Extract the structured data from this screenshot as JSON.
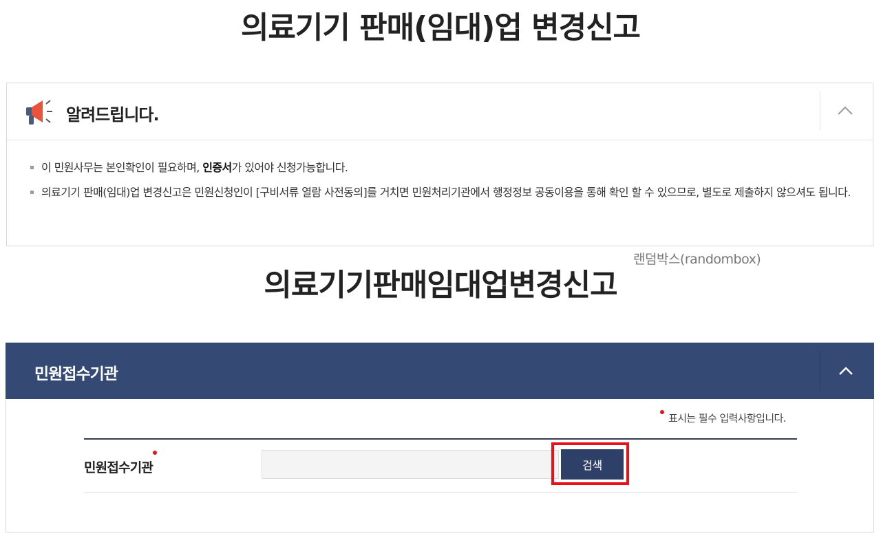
{
  "page": {
    "title": "의료기기 판매(임대)업 변경신고"
  },
  "notice": {
    "title": "알려드립니다.",
    "icon": "megaphone-icon",
    "items": [
      {
        "before": "이 민원사무는 본인확인이 필요하며, ",
        "bold": "인증서",
        "after": "가 있어야 신청가능합니다."
      },
      {
        "text": "의료기기 판매(임대)업 변경신고은 민원신청인이 [구비서류 열람 사전동의]를 거치면 민원처리기관에서 행정정보 공동이용을 통해 확인 할 수 있으므로, 별도로 제출하지 않으셔도 됩니다."
      }
    ]
  },
  "watermark": "랜덤박스(randombox)",
  "section": {
    "title": "의료기기판매임대업변경신고"
  },
  "panel": {
    "title": "민원접수기관",
    "required_note": "표시는 필수 입력사항입니다.",
    "field_label": "민원접수기관",
    "field_value": "",
    "field_placeholder": "",
    "search_label": "검색"
  },
  "colors": {
    "panel_header": "#344a74",
    "button": "#2e4068",
    "highlight": "#e8111a",
    "required": "#e0161c"
  }
}
